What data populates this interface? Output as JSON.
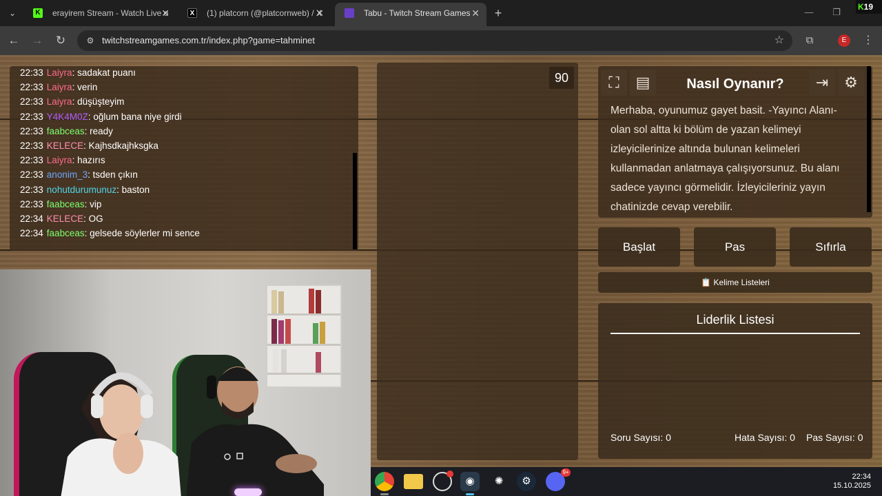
{
  "browser": {
    "tabs": [
      {
        "title": "erayirem Stream - Watch Live o",
        "favicon": "kick-icon"
      },
      {
        "title": "(1) platcorn (@platcornweb) / X",
        "favicon": "x-icon"
      },
      {
        "title": "Tabu - Twitch Stream Games",
        "favicon": "twitch-icon"
      }
    ],
    "url": "twitchstreamgames.com.tr/index.php?game=tahminet",
    "profile_initial": "E",
    "corner_badge_k": "K",
    "corner_badge_num": "19"
  },
  "chat": {
    "messages": [
      {
        "time": "22:33",
        "user": "Laiyra",
        "color": "#ff6b8a",
        "text": ": sadakat puanı"
      },
      {
        "time": "22:33",
        "user": "Laiyra",
        "color": "#ff6b8a",
        "text": ": verin"
      },
      {
        "time": "22:33",
        "user": "Laiyra",
        "color": "#ff6b8a",
        "text": ": düşüşteyim"
      },
      {
        "time": "22:33",
        "user": "Y4K4M0Z",
        "color": "#b05cff",
        "text": ": oğlum bana niye girdi"
      },
      {
        "time": "22:33",
        "user": "faabceas",
        "color": "#7cff6b",
        "text": ": ready"
      },
      {
        "time": "22:33",
        "user": "KELECE",
        "color": "#ff8fb0",
        "text": ": Kajhsdkajhksgka"
      },
      {
        "time": "22:33",
        "user": "Laiyra",
        "color": "#ff6b8a",
        "text": ": hazırıs"
      },
      {
        "time": "22:33",
        "user": "anonim_3",
        "color": "#6ba6ff",
        "text": ": tsden çıkın"
      },
      {
        "time": "22:33",
        "user": "nohutdurumunuz",
        "color": "#4fd6e8",
        "text": ": baston"
      },
      {
        "time": "22:33",
        "user": "faabceas",
        "color": "#7cff6b",
        "text": ": vip"
      },
      {
        "time": "22:34",
        "user": "KELECE",
        "color": "#ff8fb0",
        "text": ": OG"
      },
      {
        "time": "22:34",
        "user": "faabceas",
        "color": "#7cff6b",
        "text": ": gelsede söylerler mi sence"
      }
    ]
  },
  "card": {
    "timer": "90"
  },
  "howto": {
    "title": "Nasıl Oynanır?",
    "text": "Merhaba, oyunumuz gayet basit. -Yayıncı Alanı- olan sol altta ki bölüm de yazan kelimeyi izleyicilerinize altında bulunan kelimeleri kullanmadan anlatmaya çalışıyorsunuz. Bu alanı sadece yayıncı görmelidir. İzleyicileriniz yayın chatinizde cevap verebilir."
  },
  "buttons": {
    "start": "Başlat",
    "pass": "Pas",
    "reset": "Sıfırla",
    "word_lists": "Kelime Listeleri",
    "word_lists_icon": "📋"
  },
  "leaderboard": {
    "title": "Liderlik Listesi",
    "question_count": "Soru Sayısı: 0",
    "error_count": "Hata Sayısı: 0",
    "pass_count": "Pas Sayısı: 0"
  },
  "taskbar": {
    "time": "22:34",
    "date": "15.10.2025",
    "discord_badge": "9+"
  }
}
